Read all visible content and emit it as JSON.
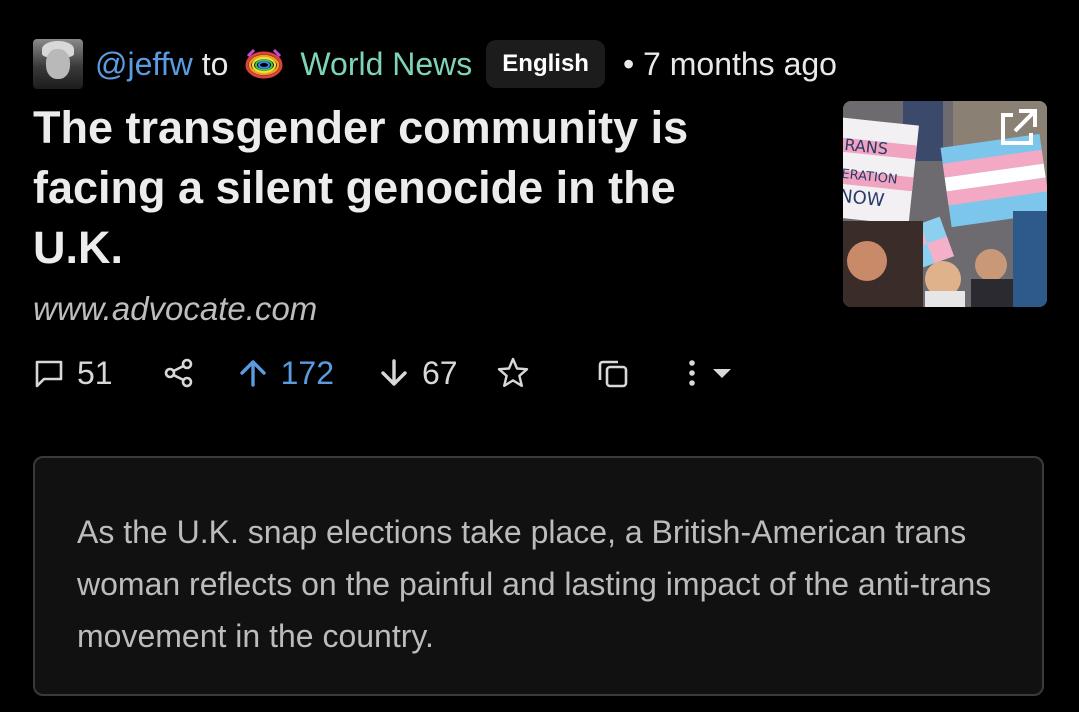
{
  "post": {
    "author": "@jeffw",
    "to_word": "to",
    "community": "World News",
    "language": "English",
    "time": "• 7 months ago",
    "title": "The transgender community is facing a silent genocide in the U.K.",
    "domain": "www.advocate.com",
    "thumbnail_text": [
      "RANS",
      "ERATION",
      "NOW"
    ],
    "body": "As the U.K. snap elections take place, a British-American trans woman reflects on the painful and lasting impact of the anti-trans movement in the country."
  },
  "actions": {
    "comments": "51",
    "upvotes": "172",
    "downvotes": "67"
  },
  "icons": {
    "comment": "comment-icon",
    "share": "share-icon",
    "upvote": "upvote-arrow-icon",
    "downvote": "downvote-arrow-icon",
    "save": "star-icon",
    "copy": "copy-icon",
    "more": "more-vertical-icon",
    "expand": "caret-down-icon",
    "open_link": "external-link-icon",
    "community": "globe-icon"
  },
  "colors": {
    "background": "#000000",
    "user_link": "#5b9be0",
    "community_link": "#7fd3b6",
    "upvote_active": "#5b9be0",
    "card_border": "#3a3a3a"
  }
}
